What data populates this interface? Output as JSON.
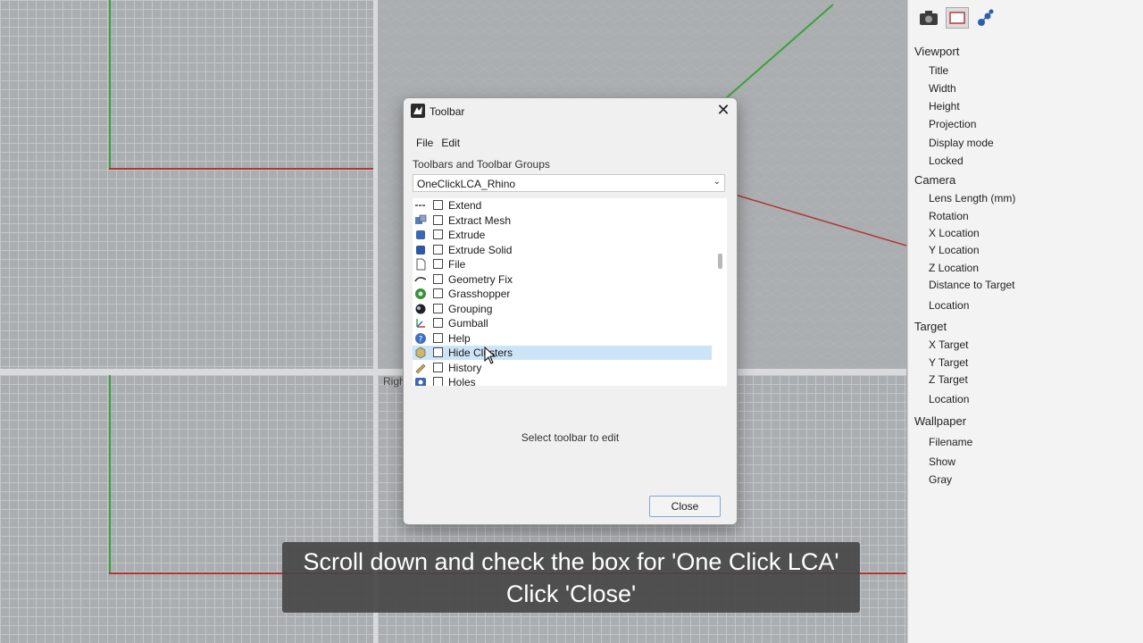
{
  "viewport_labels": {
    "bottom_right": "Righ"
  },
  "panel": {
    "tabs": [
      "camera-icon",
      "viewport-properties-icon",
      "display-icon"
    ],
    "sections": [
      {
        "heading": "Viewport",
        "items": [
          "Title",
          "Width",
          "Height",
          "Projection",
          "Display mode",
          "Locked"
        ]
      },
      {
        "heading": "Camera",
        "items": [
          "Lens Length (mm)",
          "Rotation",
          "X Location",
          "Y Location",
          "Z Location",
          "Distance to Target",
          "Location"
        ]
      },
      {
        "heading": "Target",
        "items": [
          "X Target",
          "Y Target",
          "Z Target",
          "Location"
        ]
      },
      {
        "heading": "Wallpaper",
        "items": [
          "Filename",
          "Show",
          "Gray"
        ]
      }
    ]
  },
  "dialog": {
    "title": "Toolbar",
    "close_glyph": "✕",
    "menu": [
      "File",
      "Edit"
    ],
    "groups_label": "Toolbars and Toolbar Groups",
    "combo_value": "OneClickLCA_Rhino",
    "combo_arrow": "⌄",
    "list_items": [
      {
        "label": "Extend",
        "icon": "extend-icon"
      },
      {
        "label": "Extract Mesh",
        "icon": "extract-mesh-icon"
      },
      {
        "label": "Extrude",
        "icon": "extrude-icon"
      },
      {
        "label": "Extrude Solid",
        "icon": "extrude-solid-icon"
      },
      {
        "label": "File",
        "icon": "file-icon"
      },
      {
        "label": "Geometry Fix",
        "icon": "geometry-fix-icon"
      },
      {
        "label": "Grasshopper",
        "icon": "grasshopper-icon"
      },
      {
        "label": "Grouping",
        "icon": "grouping-icon"
      },
      {
        "label": "Gumball",
        "icon": "gumball-icon"
      },
      {
        "label": "Help",
        "icon": "help-icon"
      },
      {
        "label": "Hide Clusters",
        "icon": "hide-clusters-icon",
        "selected": true
      },
      {
        "label": "History",
        "icon": "history-icon"
      },
      {
        "label": "Holes",
        "icon": "holes-icon"
      }
    ],
    "hint": "Select toolbar to edit",
    "close_button": "Close"
  },
  "caption": {
    "line1": "Scroll down and check the box for 'One Click LCA'",
    "line2": "Click 'Close'"
  }
}
